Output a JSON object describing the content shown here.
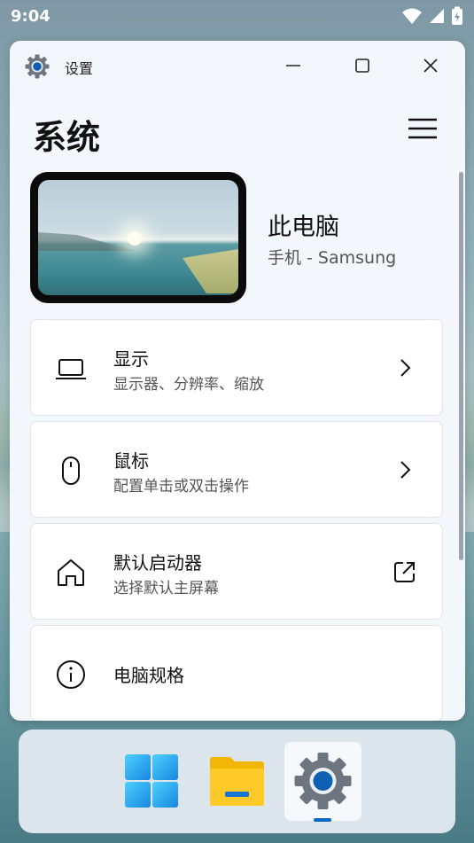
{
  "status": {
    "time": "9:04"
  },
  "window": {
    "title": "设置",
    "page_title": "系统"
  },
  "device": {
    "name": "此电脑",
    "subtitle": "手机 - Samsung"
  },
  "items": [
    {
      "title": "显示",
      "subtitle": "显示器、分辨率、缩放",
      "icon": "laptop-icon",
      "action": "chevron-right-icon"
    },
    {
      "title": "鼠标",
      "subtitle": "配置单击或双击操作",
      "icon": "mouse-icon",
      "action": "chevron-right-icon"
    },
    {
      "title": "默认启动器",
      "subtitle": "选择默认主屏幕",
      "icon": "home-icon",
      "action": "open-external-icon"
    },
    {
      "title": "电脑规格",
      "icon": "info-icon"
    }
  ],
  "taskbar": {
    "apps": [
      "start-icon",
      "file-explorer-icon",
      "settings-icon"
    ],
    "active": "settings-icon",
    "accent": "#0067c0"
  },
  "colors": {
    "window_bg": "#f3f6fb",
    "card_bg": "#ffffff",
    "accent": "#0067c0"
  }
}
